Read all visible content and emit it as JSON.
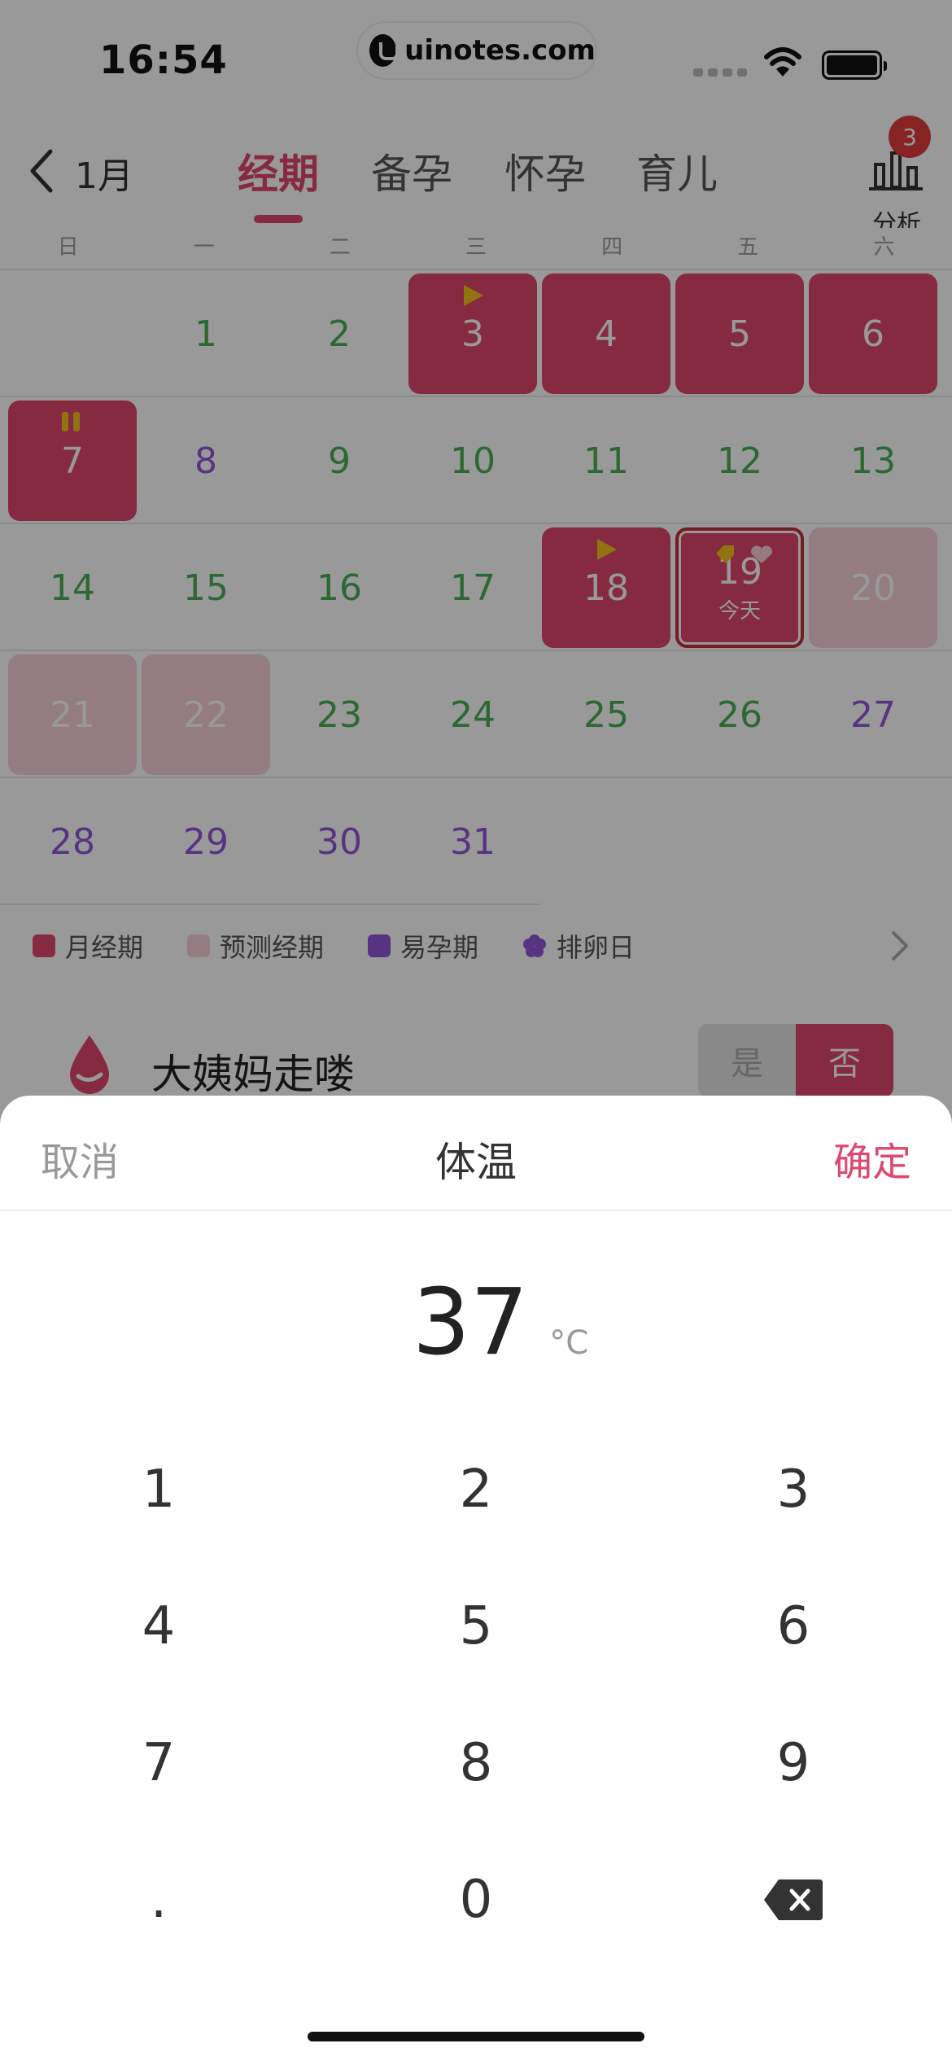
{
  "status_bar": {
    "time": "16:54",
    "url": "uinotes.com"
  },
  "header": {
    "back_month": "1月",
    "tabs": [
      {
        "label": "经期",
        "active": true
      },
      {
        "label": "备孕",
        "active": false
      },
      {
        "label": "怀孕",
        "active": false
      },
      {
        "label": "育儿",
        "active": false
      }
    ],
    "analysis_label": "分析",
    "badge_count": "3"
  },
  "calendar": {
    "weekdays": [
      "日",
      "一",
      "二",
      "三",
      "四",
      "五",
      "六"
    ],
    "today_label": "今天",
    "weeks": [
      [
        null,
        {
          "d": "1",
          "s": "green"
        },
        {
          "d": "2",
          "s": "green"
        },
        {
          "d": "3",
          "s": "period",
          "mark": "start"
        },
        {
          "d": "4",
          "s": "period"
        },
        {
          "d": "5",
          "s": "period"
        },
        {
          "d": "6",
          "s": "period"
        }
      ],
      [
        {
          "d": "7",
          "s": "period",
          "mark": "pause"
        },
        {
          "d": "8",
          "s": "purple"
        },
        {
          "d": "9",
          "s": "green"
        },
        {
          "d": "10",
          "s": "green"
        },
        {
          "d": "11",
          "s": "green"
        },
        {
          "d": "12",
          "s": "green"
        },
        {
          "d": "13",
          "s": "green"
        }
      ],
      [
        {
          "d": "14",
          "s": "green"
        },
        {
          "d": "15",
          "s": "green"
        },
        {
          "d": "16",
          "s": "green"
        },
        {
          "d": "17",
          "s": "green"
        },
        {
          "d": "18",
          "s": "period",
          "mark": "start"
        },
        {
          "d": "19",
          "s": "period",
          "today": true,
          "mark": "tag-heart"
        },
        {
          "d": "20",
          "s": "predict"
        }
      ],
      [
        {
          "d": "21",
          "s": "predict"
        },
        {
          "d": "22",
          "s": "predict"
        },
        {
          "d": "23",
          "s": "green"
        },
        {
          "d": "24",
          "s": "green"
        },
        {
          "d": "25",
          "s": "green"
        },
        {
          "d": "26",
          "s": "green"
        },
        {
          "d": "27",
          "s": "purple"
        }
      ],
      [
        {
          "d": "28",
          "s": "purple"
        },
        {
          "d": "29",
          "s": "purple"
        },
        {
          "d": "30",
          "s": "purple"
        },
        {
          "d": "31",
          "s": "purple"
        },
        null,
        null,
        null
      ]
    ]
  },
  "legend": [
    {
      "label": "月经期",
      "color": "#e0476f",
      "shape": "square"
    },
    {
      "label": "预测经期",
      "color": "#f6cfd9",
      "shape": "square"
    },
    {
      "label": "易孕期",
      "color": "#9158d8",
      "shape": "square"
    },
    {
      "label": "排卵日",
      "color": "#9158d8",
      "shape": "flower"
    }
  ],
  "card": {
    "title": "大姨妈走喽",
    "yes": "是",
    "no": "否"
  },
  "sheet": {
    "cancel": "取消",
    "title": "体温",
    "confirm": "确定",
    "value": "37",
    "unit": "°C",
    "keys": [
      "1",
      "2",
      "3",
      "4",
      "5",
      "6",
      "7",
      "8",
      "9",
      ".",
      "0",
      "backspace-icon"
    ]
  },
  "colors": {
    "accent": "#e0476f",
    "predict": "#f6cfd9",
    "fertile": "#9158d8",
    "normal_day": "#48ad58",
    "marker": "#f2c21b"
  }
}
